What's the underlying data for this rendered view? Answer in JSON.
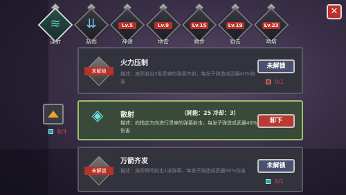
{
  "tabs": [
    {
      "label": "连射",
      "level": "",
      "active": true,
      "icon": "claw-icon"
    },
    {
      "label": "箭雨",
      "level": "",
      "active": false,
      "icon": "arrow-rain-icon"
    },
    {
      "label": "神速",
      "level": "Lv.5",
      "active": false,
      "icon": "speed-icon"
    },
    {
      "label": "地雷",
      "level": "Lv.9",
      "active": false,
      "icon": "mine-icon"
    },
    {
      "label": "瞬步",
      "level": "Lv.15",
      "active": false,
      "icon": "blink-icon"
    },
    {
      "label": "狙击",
      "level": "Lv.19",
      "active": false,
      "icon": "snipe-icon"
    },
    {
      "label": "哨塔",
      "level": "Lv.23",
      "active": false,
      "icon": "turret-icon"
    }
  ],
  "close": {
    "glyph": "✕"
  },
  "upgrade": {
    "count": "0/3"
  },
  "skills": [
    {
      "name": "火力压制",
      "lock_tag": "未解锁",
      "desc": "描述：扇形射出3发贯穿的弹幕齐射，每发子弹造成武器40%伤害",
      "button": "未解锁",
      "cost": "0/1"
    },
    {
      "name": "散射",
      "stats": "（耗能：25  冷却：3）",
      "desc": "描述：向指定方向进行贯穿的弹幕射击，每发子弹造成武器40%伤害",
      "button": "卸下"
    },
    {
      "name": "万箭齐发",
      "lock_tag": "未解锁",
      "desc": "描述：扇形瞬间射出1波弹幕，每发子弹造成武器50%伤害",
      "button": "未解锁",
      "cost": "0/1"
    }
  ],
  "colors": {
    "accent_red": "#b8322a",
    "selected_border": "#9fc06a",
    "teal": "#2aa0a0"
  }
}
